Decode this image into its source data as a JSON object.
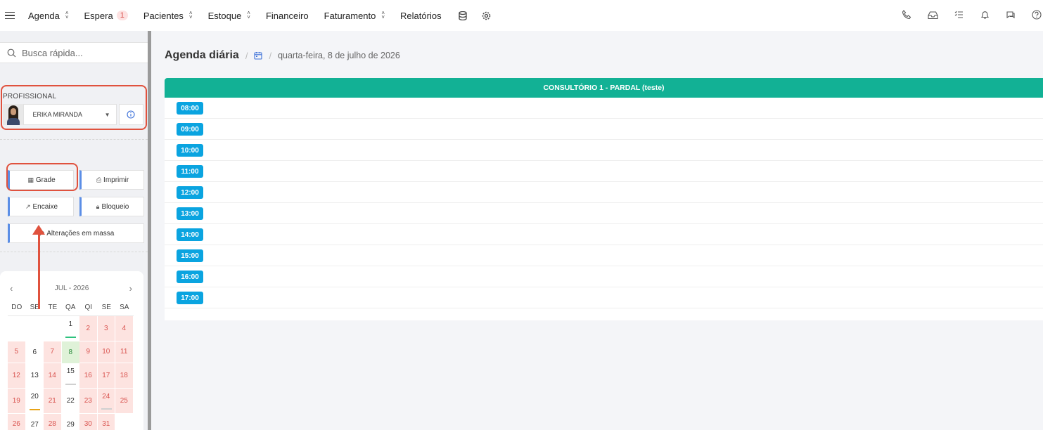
{
  "nav": {
    "items": [
      {
        "label": "Agenda",
        "chevron": true
      },
      {
        "label": "Espera",
        "badge": "1"
      },
      {
        "label": "Pacientes",
        "chevron": true
      },
      {
        "label": "Estoque",
        "chevron": true
      },
      {
        "label": "Financeiro"
      },
      {
        "label": "Faturamento",
        "chevron": true
      },
      {
        "label": "Relatórios"
      }
    ],
    "left_icons": [
      "database-icon",
      "gear-icon"
    ],
    "right_icons": [
      "phone-icon",
      "inbox-icon",
      "task-list-icon",
      "bell-icon",
      "chat-icon",
      "help-icon"
    ]
  },
  "sidebar": {
    "search_placeholder": "Busca rápida...",
    "professional_label": "PROFISSIONAL",
    "professional_name": "ERIKA MIRANDA",
    "buttons": {
      "grade": "Grade",
      "imprimir": "Imprimir",
      "encaixe": "Encaixe",
      "bloqueio": "Bloqueio",
      "alteracoes": "Alterações em massa"
    }
  },
  "calendar": {
    "month_label": "JUL - 2026",
    "weekdays": [
      "DO",
      "SE",
      "TE",
      "QA",
      "QI",
      "SE",
      "SA"
    ],
    "weeks": [
      [
        null,
        null,
        null,
        "1",
        "2",
        "3",
        "4"
      ],
      [
        "5",
        "6",
        "7",
        "8",
        "9",
        "10",
        "11"
      ],
      [
        "12",
        "13",
        "14",
        "15",
        "16",
        "17",
        "18"
      ],
      [
        "19",
        "20",
        "21",
        "22",
        "23",
        "24",
        "25"
      ],
      [
        "26",
        "27",
        "28",
        "29",
        "30",
        "31",
        null
      ]
    ]
  },
  "main": {
    "title": "Agenda diária",
    "separator": "/",
    "date": "quarta-feira, 8 de julho de 2026",
    "room": "CONSULTÓRIO 1 - PARDAL (teste)",
    "slots": [
      "08:00",
      "09:00",
      "10:00",
      "11:00",
      "12:00",
      "13:00",
      "14:00",
      "15:00",
      "16:00",
      "17:00"
    ]
  },
  "colors": {
    "room_header": "#12b195",
    "time_badge": "#0aa4e0",
    "highlight": "#e0523e",
    "accent_border": "#5b8ee6"
  }
}
